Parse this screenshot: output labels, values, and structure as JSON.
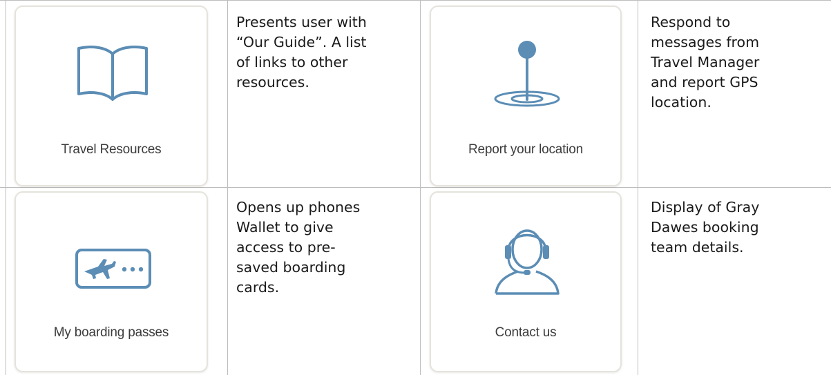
{
  "rows": [
    {
      "left": {
        "card_label": "Travel Resources",
        "icon": "open-book-icon",
        "description": "Presents user with\n“Our Guide”. A list\nof links to other\nresources."
      },
      "right": {
        "card_label": "Report your location",
        "icon": "map-pin-icon",
        "description": "Respond to\nmessages from\nTravel Manager\nand report GPS\nlocation."
      }
    },
    {
      "left": {
        "card_label": "My boarding passes",
        "icon": "boarding-pass-icon",
        "description": "Opens up phones\nWallet to give\naccess to pre-\nsaved boarding\ncards."
      },
      "right": {
        "card_label": "Contact us",
        "icon": "headset-agent-icon",
        "description": "Display of Gray\nDawes booking\nteam details."
      }
    }
  ],
  "colors": {
    "icon_stroke": "#5b8db5",
    "grid_line": "#bdbdbd",
    "card_border": "#e5e3dc"
  }
}
